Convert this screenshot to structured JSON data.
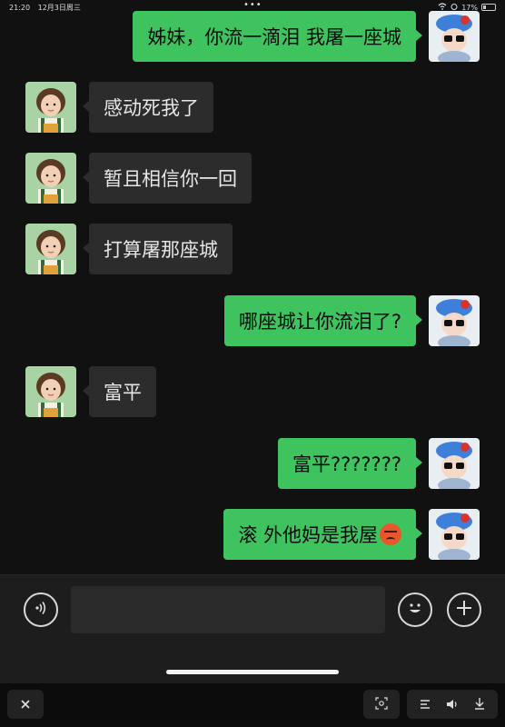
{
  "status_bar": {
    "time": "21:20",
    "date": "12月3日周三",
    "battery": "17%"
  },
  "messages": [
    {
      "side": "right",
      "text": "姊妹，你流一滴泪 我屠一座城"
    },
    {
      "side": "left",
      "text": "感动死我了"
    },
    {
      "side": "left",
      "text": "暂且相信你一回"
    },
    {
      "side": "left",
      "text": "打算屠那座城"
    },
    {
      "side": "right",
      "text": "哪座城让你流泪了?"
    },
    {
      "side": "left",
      "text": "富平"
    },
    {
      "side": "right",
      "text": "富平???????"
    },
    {
      "side": "right",
      "text": "滚 外他妈是我屋",
      "emoji": "angry-face-emoji"
    }
  ],
  "icons": {
    "voice": "voice-icon",
    "emoji": "emoji-face-icon",
    "add": "plus-icon",
    "close": "close-icon",
    "screenshot": "scan-screenshot-icon",
    "menu": "list-icon",
    "volume": "speaker-icon",
    "download": "download-icon",
    "wifi": "wifi-icon",
    "alarm": "alarm-icon"
  },
  "colors": {
    "own_bubble": "#3fc35f",
    "other_bubble": "#2c2c2c",
    "background": "#111111"
  }
}
